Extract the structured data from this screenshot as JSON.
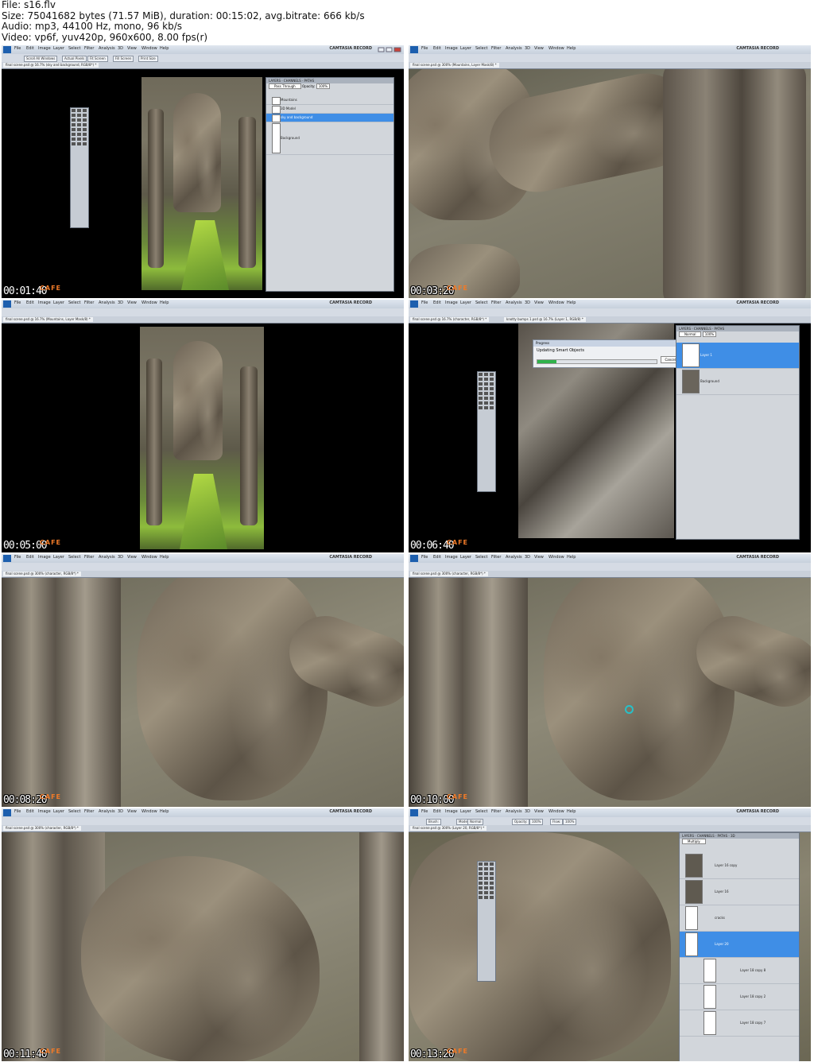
{
  "header": {
    "file": "File: s16.flv",
    "size": "Size: 75041682 bytes (71.57 MiB), duration: 00:15:02, avg.bitrate: 666 kb/s",
    "audio": "Audio: mp3, 44100 Hz, mono, 96 kb/s",
    "video": "Video: vp6f, yuv420p, 960x600,  8.00 fps(r)"
  },
  "app": {
    "menu": [
      "File",
      "Edit",
      "Image",
      "Layer",
      "Select",
      "Filter",
      "Analysis",
      "3D",
      "View",
      "Window",
      "Help"
    ],
    "recorder": "CAMTASIA RECORD",
    "logo": "CAFE"
  },
  "frames": [
    {
      "timestamp": "00:01:40",
      "tab": "final scene.psd @ 16.7% (sky and background, RGB/8*) *",
      "options": [
        "Scroll All Windows",
        "Actual Pixels",
        "Fit Screen",
        "Fill Screen",
        "Print Size"
      ],
      "layers": [
        "Mountains",
        "3D Model",
        "sky and background",
        "Background"
      ],
      "selected_layer": "sky and background",
      "blend_mode": "Pass Through",
      "opacity_label": "Opacity:",
      "opacity": "100%",
      "panel_tabs": [
        "LAYERS",
        "CHANNELS",
        "PATHS"
      ]
    },
    {
      "timestamp": "00:03:20",
      "tab": "final scene.psd @ 300% (Mountains, Layer Mask/8) *"
    },
    {
      "timestamp": "00:05:00",
      "tab": "final scene.psd @ 16.7% (Mountains, Layer Mask/8) *"
    },
    {
      "timestamp": "00:06:40",
      "tab": "final scene.psd @ 16.7% (character, RGB/8*) *",
      "tab2": "knotty bumps 1.psd @ 16.7% (Layer 1, RGB/8) *",
      "dialog_title": "Progress",
      "dialog_text": "Updating Smart Objects",
      "dialog_button": "Cancel",
      "layers": [
        "Layer 1",
        "Background"
      ],
      "selected_layer": "Layer 1",
      "blend_mode": "Normal",
      "opacity": "100%",
      "panel_tabs": [
        "LAYERS",
        "CHANNELS",
        "PATHS"
      ]
    },
    {
      "timestamp": "00:08:20",
      "tab": "final scene.psd @ 300% (character, RGB/8*) *"
    },
    {
      "timestamp": "00:10:00",
      "tab": "final scene.psd @ 300% (character, RGB/8*) *"
    },
    {
      "timestamp": "00:11:40",
      "tab": "final scene.psd @ 300% (character, RGB/8*) *"
    },
    {
      "timestamp": "00:13:20",
      "tab": "final scene.psd @ 300% (Layer 20, RGB/8*) *",
      "brush_label": "Brush:",
      "mode_label": "Mode:",
      "mode": "Normal",
      "opacity_label": "Opacity:",
      "opacity": "100%",
      "flow_label": "Flow:",
      "flow": "100%",
      "blend_mode": "Multiply",
      "layers": [
        "Layer 16 copy",
        "Layer 16",
        "cracks",
        "Layer 20",
        "Layer 18 copy 8",
        "Layer 18 copy 2",
        "Layer 18 copy 7"
      ],
      "selected_layer": "Layer 20",
      "panel_tabs": [
        "LAYERS",
        "CHANNELS",
        "PATHS",
        "3D"
      ]
    }
  ],
  "colors": {
    "selection": "#3f8ee6",
    "menubar": "#d3dbe6",
    "stamp": "#ffffff",
    "logo": "#f07a28"
  }
}
